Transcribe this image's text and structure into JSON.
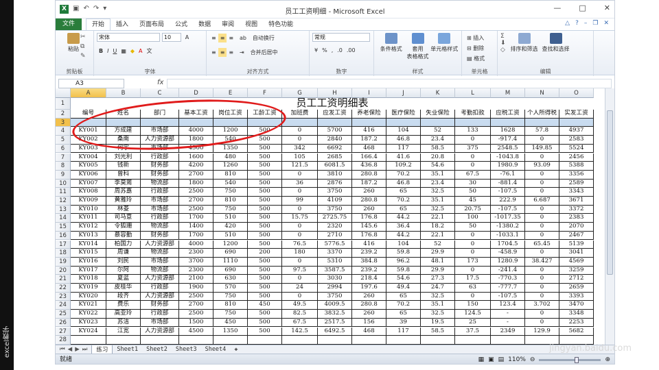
{
  "side_label": "excel教学",
  "window": {
    "title": "员工工资明细 - Microsoft Excel"
  },
  "menu": {
    "file": "文件",
    "tabs": [
      "开始",
      "插入",
      "页面布局",
      "公式",
      "数据",
      "审阅",
      "视图",
      "特色功能"
    ]
  },
  "ribbon": {
    "clipboard": {
      "label": "剪贴板",
      "paste": "粘贴"
    },
    "font": {
      "label": "字体",
      "name": "宋体",
      "size": "10"
    },
    "align": {
      "label": "对齐方式",
      "wrap": "自动换行",
      "merge": "合并后居中"
    },
    "number": {
      "label": "数字",
      "format": "常规"
    },
    "styles": {
      "label": "样式",
      "cond": "条件格式",
      "table": "套用\n表格格式",
      "cell": "单元格样式"
    },
    "cells": {
      "label": "单元格",
      "insert": "插入",
      "delete": "删除",
      "format": "格式"
    },
    "edit": {
      "label": "编辑",
      "sort": "排序和筛选",
      "find": "查找和选择"
    }
  },
  "formula_bar": {
    "name_box": "A3",
    "fx": "fx",
    "value": ""
  },
  "columns": [
    "A",
    "B",
    "C",
    "D",
    "E",
    "F",
    "G",
    "H",
    "I",
    "J",
    "K",
    "L",
    "M",
    "N",
    "O"
  ],
  "sheet_title": "员工工资明细表",
  "headers": [
    "编号",
    "姓名",
    "部门",
    "基本工资",
    "岗位工资",
    "工龄工资",
    "加班费",
    "应发工资",
    "养老保险",
    "医疗保险",
    "失业保险",
    "考勤扣款",
    "应税工资",
    "个人所得税",
    "实发工资"
  ],
  "rows": [
    [
      "KY001",
      "方成建",
      "市场部",
      "4000",
      "1200",
      "500",
      "0",
      "5700",
      "416",
      "104",
      "52",
      "133",
      "1628",
      "57.8",
      "4937"
    ],
    [
      "KY002",
      "桑南",
      "人力资源部",
      "1800",
      "540",
      "500",
      "0",
      "2840",
      "187.2",
      "46.8",
      "23.4",
      "0",
      "-917.4",
      "0",
      "2583"
    ],
    [
      "KY003",
      "何宇",
      "市场部",
      "4500",
      "1350",
      "500",
      "342",
      "6692",
      "468",
      "117",
      "58.5",
      "375",
      "2548.5",
      "149.85",
      "5524"
    ],
    [
      "KY004",
      "刘光利",
      "行政部",
      "1600",
      "480",
      "500",
      "105",
      "2685",
      "166.4",
      "41.6",
      "20.8",
      "0",
      "-1043.8",
      "0",
      "2456"
    ],
    [
      "KY005",
      "钱新",
      "财务部",
      "4200",
      "1260",
      "500",
      "121.5",
      "6081.5",
      "436.8",
      "109.2",
      "54.6",
      "0",
      "1980.9",
      "93.09",
      "5388"
    ],
    [
      "KY006",
      "曾科",
      "财务部",
      "2700",
      "810",
      "500",
      "0",
      "3810",
      "280.8",
      "70.2",
      "35.1",
      "67.5",
      "-76.1",
      "0",
      "3356"
    ],
    [
      "KY007",
      "李莫蔫",
      "物流部",
      "1800",
      "540",
      "500",
      "36",
      "2876",
      "187.2",
      "46.8",
      "23.4",
      "30",
      "-881.4",
      "0",
      "2589"
    ],
    [
      "KY008",
      "周苏嘉",
      "行政部",
      "2500",
      "750",
      "500",
      "0",
      "3750",
      "260",
      "65",
      "32.5",
      "50",
      "-107.5",
      "0",
      "3343"
    ],
    [
      "KY009",
      "黄雅玲",
      "市场部",
      "2700",
      "810",
      "500",
      "99",
      "4109",
      "280.8",
      "70.2",
      "35.1",
      "45",
      "222.9",
      "6.687",
      "3671"
    ],
    [
      "KY010",
      "林菱",
      "市场部",
      "2500",
      "750",
      "500",
      "0",
      "3750",
      "260",
      "65",
      "32.5",
      "20.75",
      "-107.5",
      "0",
      "3372"
    ],
    [
      "KY011",
      "司马意",
      "行政部",
      "1700",
      "510",
      "500",
      "15.75",
      "2725.75",
      "176.8",
      "44.2",
      "22.1",
      "100",
      "-1017.35",
      "0",
      "2383"
    ],
    [
      "KY012",
      "令狐珊",
      "物流部",
      "1400",
      "420",
      "500",
      "0",
      "2320",
      "145.6",
      "36.4",
      "18.2",
      "50",
      "-1380.2",
      "0",
      "2070"
    ],
    [
      "KY013",
      "慕容勤",
      "财务部",
      "1700",
      "510",
      "500",
      "0",
      "2710",
      "176.8",
      "44.2",
      "22.1",
      "0",
      "-1033.1",
      "0",
      "2467"
    ],
    [
      "KY014",
      "柏国力",
      "人力资源部",
      "4000",
      "1200",
      "500",
      "76.5",
      "5776.5",
      "416",
      "104",
      "52",
      "0",
      "1704.5",
      "65.45",
      "5139"
    ],
    [
      "KY015",
      "周谦",
      "物流部",
      "2300",
      "690",
      "200",
      "180",
      "3370",
      "239.2",
      "59.8",
      "29.9",
      "0",
      "-458.9",
      "0",
      "3041"
    ],
    [
      "KY016",
      "刘民",
      "市场部",
      "3700",
      "1110",
      "500",
      "0",
      "5310",
      "384.8",
      "96.2",
      "48.1",
      "173",
      "1280.9",
      "38.427",
      "4569"
    ],
    [
      "KY017",
      "尔阿",
      "物流部",
      "2300",
      "690",
      "500",
      "97.5",
      "3587.5",
      "239.2",
      "59.8",
      "29.9",
      "0",
      "-241.4",
      "0",
      "3259"
    ],
    [
      "KY018",
      "夏蓝",
      "人力资源部",
      "2100",
      "630",
      "500",
      "0",
      "3030",
      "218.4",
      "54.6",
      "27.3",
      "17.5",
      "-770.3",
      "0",
      "2712"
    ],
    [
      "KY019",
      "皮桂华",
      "行政部",
      "1900",
      "570",
      "500",
      "24",
      "2994",
      "197.6",
      "49.4",
      "24.7",
      "63",
      "-777.7",
      "0",
      "2659"
    ],
    [
      "KY020",
      "段齐",
      "人力资源部",
      "2500",
      "750",
      "500",
      "0",
      "3750",
      "260",
      "65",
      "32.5",
      "0",
      "-107.5",
      "0",
      "3393"
    ],
    [
      "KY021",
      "费乐",
      "财务部",
      "2700",
      "810",
      "450",
      "49.5",
      "4009.5",
      "280.8",
      "70.2",
      "35.1",
      "150",
      "123.4",
      "3.702",
      "3470"
    ],
    [
      "KY022",
      "高亚玲",
      "行政部",
      "2500",
      "750",
      "500",
      "82.5",
      "3832.5",
      "260",
      "65",
      "32.5",
      "124.5",
      "-",
      "0",
      "3348"
    ],
    [
      "KY023",
      "苏洁",
      "市场部",
      "1500",
      "450",
      "500",
      "67.5",
      "2517.5",
      "156",
      "39",
      "19.5",
      "25",
      "-",
      "0",
      "2253"
    ],
    [
      "KY024",
      "江宽",
      "人力资源部",
      "4500",
      "1350",
      "500",
      "142.5",
      "6492.5",
      "468",
      "117",
      "58.5",
      "37.5",
      "2349",
      "129.9",
      "5682"
    ]
  ],
  "sheets": [
    "练习",
    "Sheet1",
    "Sheet2",
    "Sheet3",
    "Sheet4"
  ],
  "status": {
    "ready": "就绪",
    "zoom": "110%"
  },
  "watermark": "jingyan.baidu.com"
}
